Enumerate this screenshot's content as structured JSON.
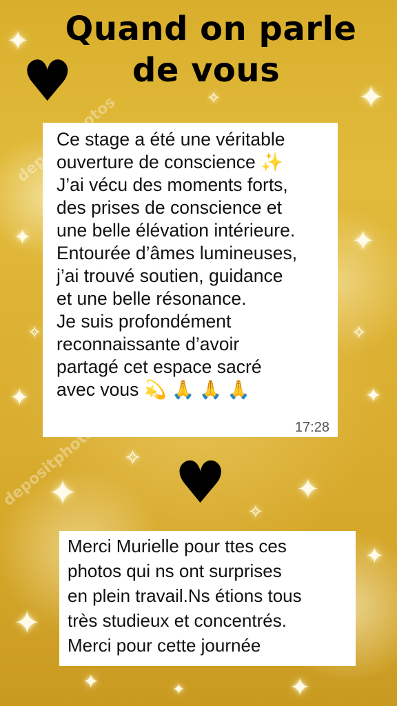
{
  "title": {
    "line1": "Quand on parle",
    "line2": "de vous"
  },
  "watermark": "depositphotos",
  "testimonial": {
    "text": "Ce stage a été une véritable\nouverture de conscience ✨\nJ’ai vécu des moments forts,\ndes prises de conscience et\nune belle élévation intérieure.\nEntourée d’âmes lumineuses,\nj’ai trouvé soutien, guidance\net une belle résonance.\nJe suis profondément\nreconnaissante d’avoir\npartagé cet espace sacré\navec vous 💫 🙏 🙏 🙏",
    "time": "17:28"
  },
  "thanks": {
    "text": "Merci Murielle pour ttes ces\nphotos qui ns ont surprises\nen plein travail.Ns étions tous\ntrès studieux et concentrés.\nMerci pour cette journée"
  },
  "icons": {
    "heart_top": "heart-icon",
    "heart_middle": "heart-icon"
  },
  "colors": {
    "background": "#dcb032",
    "card": "#ffffff",
    "text": "#000000"
  }
}
